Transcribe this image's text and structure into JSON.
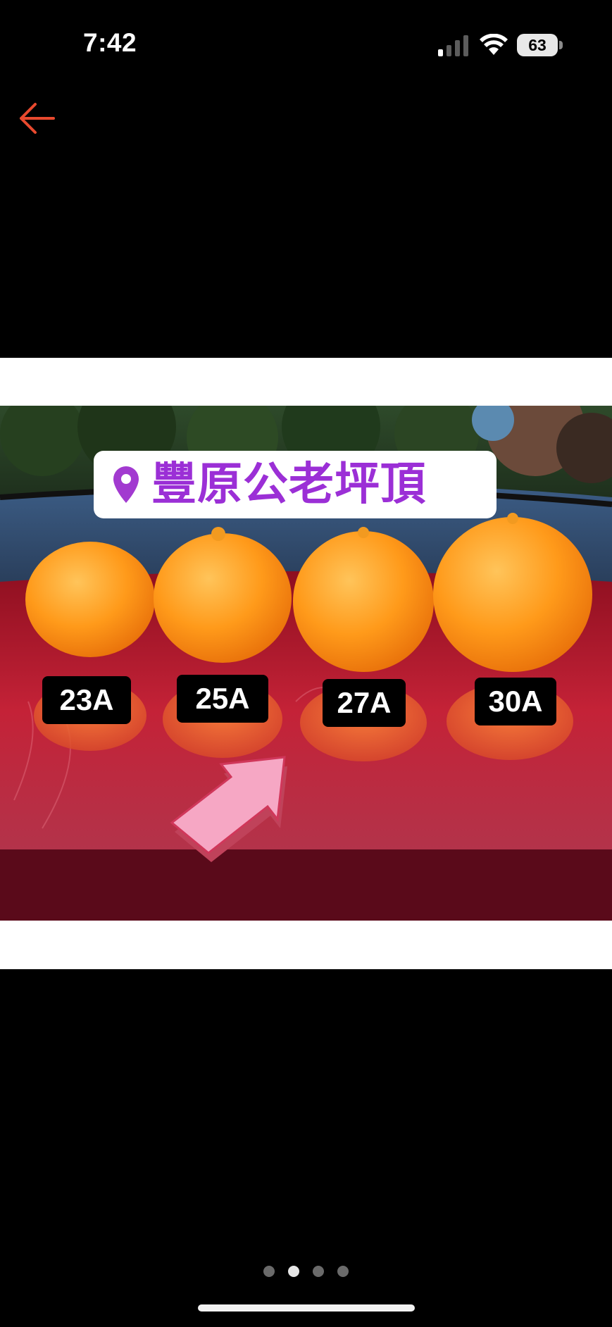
{
  "status_bar": {
    "time": "7:42",
    "battery": "63",
    "icons": [
      "signal-icon",
      "wifi-icon",
      "battery-icon"
    ]
  },
  "nav": {
    "back_icon": "arrow-left-icon",
    "accent_color": "#e8492e"
  },
  "photo": {
    "location_label": "豐原公老坪頂",
    "location_icon": "map-pin-icon",
    "location_color": "#9b2fd6",
    "size_labels": [
      "23A",
      "25A",
      "27A",
      "30A"
    ],
    "arrow_color": "#f6a7c4"
  },
  "pager": {
    "total": 4,
    "active_index": 1
  }
}
